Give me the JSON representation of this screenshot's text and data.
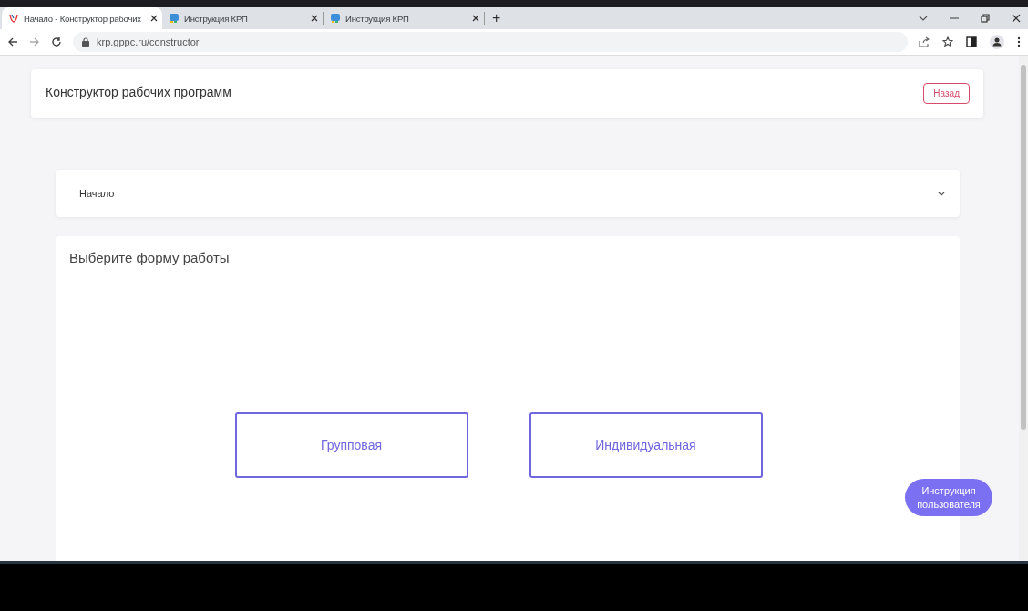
{
  "browser": {
    "tabs": [
      {
        "title": "Начало - Конструктор рабочих",
        "kind": "logo",
        "selected": true
      },
      {
        "title": "Инструкция КРП",
        "kind": "doc",
        "selected": false
      },
      {
        "title": "Инструкция КРП",
        "kind": "doc",
        "selected": false
      }
    ],
    "new_tab": "+",
    "address": "krp.gppc.ru/constructor"
  },
  "header": {
    "title": "Конструктор рабочих программ",
    "back_button": "Назад"
  },
  "accordion": {
    "label": "Начало",
    "expanded": false
  },
  "form_card": {
    "heading": "Выберите форму работы",
    "options": [
      {
        "label": "Групповая"
      },
      {
        "label": "Индивидуальная"
      }
    ]
  },
  "help_button": "Инструкция пользователя"
}
